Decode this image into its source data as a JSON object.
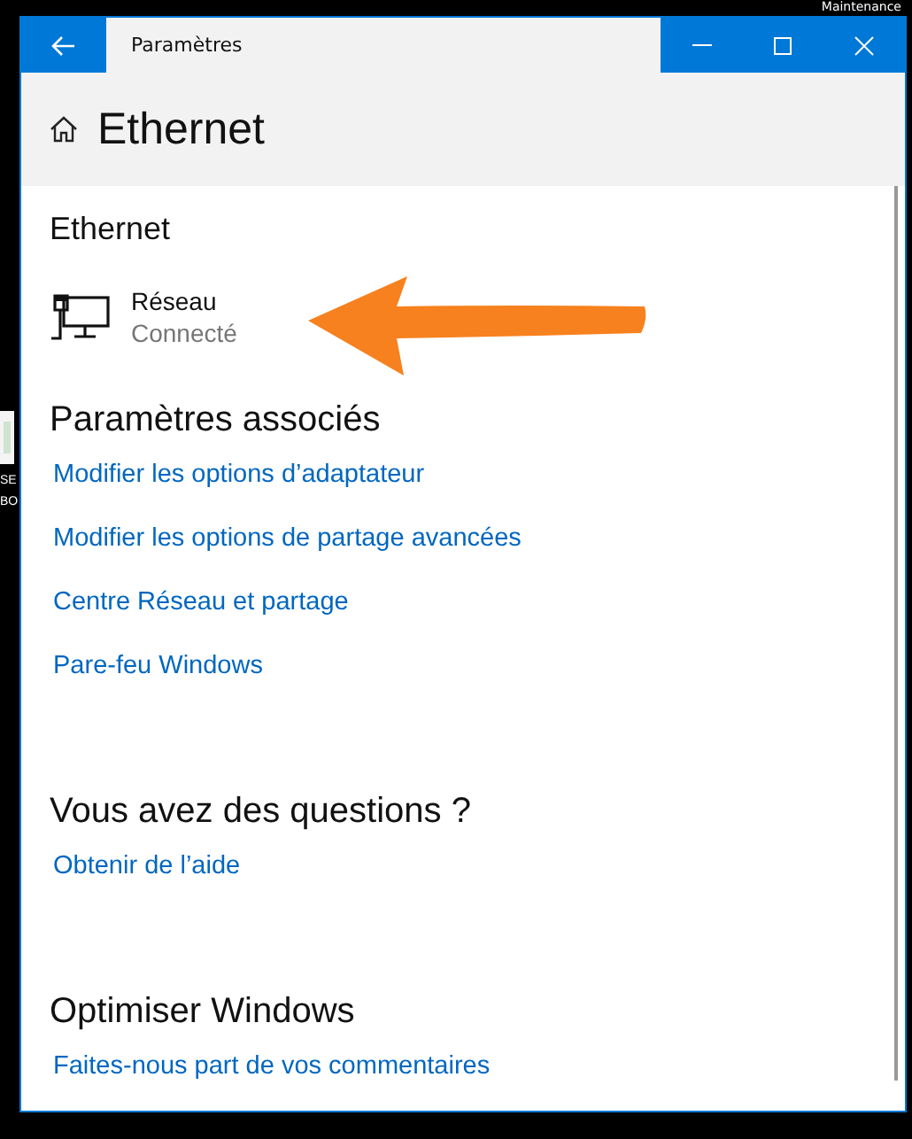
{
  "desktop": {
    "caption": "Maintenance",
    "icon_labels": [
      "SE",
      "BO"
    ]
  },
  "window": {
    "title": "Paramètres"
  },
  "header": {
    "title": "Ethernet"
  },
  "section": {
    "title": "Ethernet"
  },
  "network": {
    "name": "Réseau",
    "status": "Connecté"
  },
  "related": {
    "title": "Paramètres associés",
    "links": [
      "Modifier les options d’adaptateur",
      "Modifier les options de partage avancées",
      "Centre Réseau et partage",
      "Pare-feu Windows"
    ]
  },
  "questions": {
    "title": "Vous avez des questions ?",
    "links": [
      "Obtenir de l’aide"
    ]
  },
  "optimize": {
    "title": "Optimiser Windows",
    "links": [
      "Faites-nous part de vos commentaires"
    ]
  }
}
